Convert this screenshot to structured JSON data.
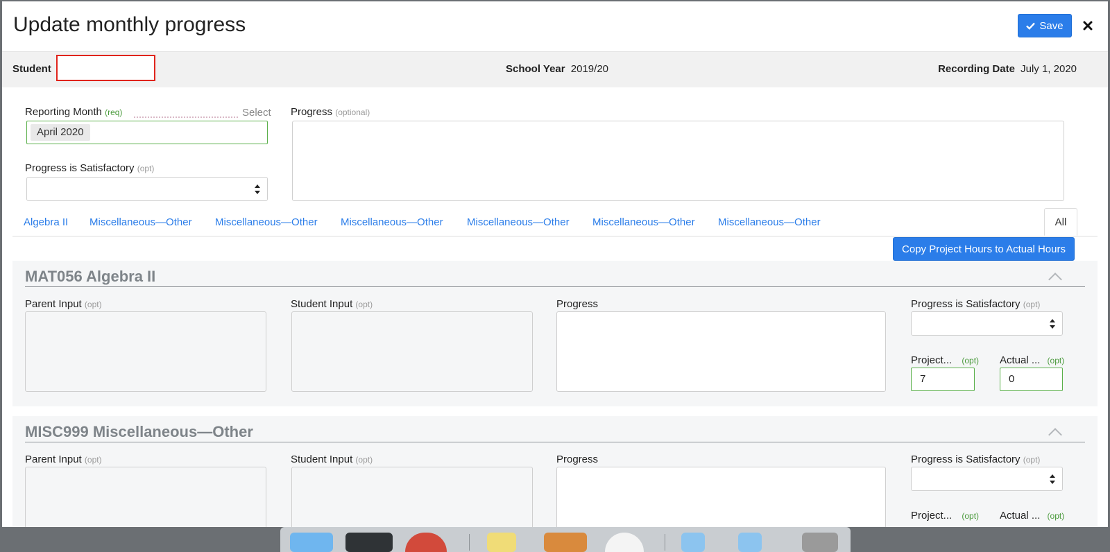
{
  "modal": {
    "title": "Update monthly progress",
    "save_label": "Save"
  },
  "info_bar": {
    "student_label": "Student",
    "student_value": "",
    "school_year_label": "School Year",
    "school_year_value": "2019/20",
    "recording_date_label": "Recording Date",
    "recording_date_value": "July 1, 2020"
  },
  "form": {
    "reporting_month_label": "Reporting Month",
    "reporting_month_hint": "(req)",
    "reporting_month_select": "Select",
    "reporting_month_value": "April 2020",
    "satisfactory_label": "Progress is Satisfactory",
    "satisfactory_hint": "(opt)",
    "progress_label": "Progress",
    "progress_hint": "(optional)"
  },
  "tabs": [
    {
      "label": "Algebra II"
    },
    {
      "label": "Miscellaneous—Other"
    },
    {
      "label": "Miscellaneous—Other"
    },
    {
      "label": "Miscellaneous—Other"
    },
    {
      "label": "Miscellaneous—Other"
    },
    {
      "label": "Miscellaneous—Other"
    },
    {
      "label": "Miscellaneous—Other"
    }
  ],
  "tab_all_label": "All",
  "copy_button_label": "Copy Project Hours to Actual Hours",
  "course_fields": {
    "parent_label": "Parent Input",
    "student_label": "Student Input",
    "progress_label": "Progress",
    "satisfactory_label": "Progress is Satisfactory",
    "opt_hint": "(opt)",
    "projected_label": "Project...",
    "actual_label": "Actual ..."
  },
  "courses": [
    {
      "title": "MAT056 Algebra II",
      "projected_hours": "7",
      "actual_hours": "0"
    },
    {
      "title": "MISC999 Miscellaneous—Other",
      "projected_hours": "",
      "actual_hours": ""
    }
  ],
  "icons": {
    "save": "check-icon",
    "close": "close-icon",
    "collapse": "chevron-up-icon",
    "select": "updown-arrows-icon"
  },
  "colors": {
    "primary": "#2b7de9",
    "valid_border": "#5bb04b",
    "error_border": "#e0241c",
    "course_title": "#7e8489"
  }
}
